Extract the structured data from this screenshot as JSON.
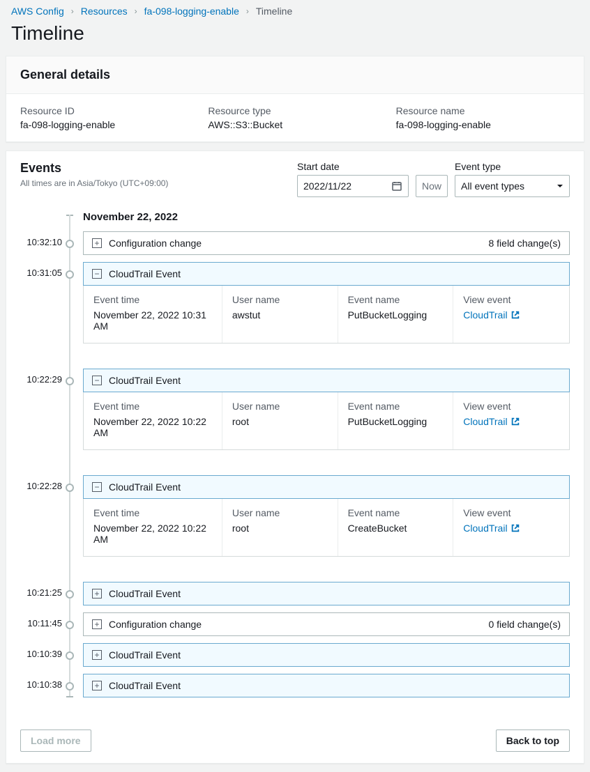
{
  "breadcrumb": {
    "items": [
      {
        "label": "AWS Config",
        "link": true
      },
      {
        "label": "Resources",
        "link": true
      },
      {
        "label": "fa-098-logging-enable",
        "link": true
      },
      {
        "label": "Timeline",
        "link": false
      }
    ]
  },
  "page_title": "Timeline",
  "general": {
    "heading": "General details",
    "resource_id_label": "Resource ID",
    "resource_id": "fa-098-logging-enable",
    "resource_type_label": "Resource type",
    "resource_type": "AWS::S3::Bucket",
    "resource_name_label": "Resource name",
    "resource_name": "fa-098-logging-enable"
  },
  "events": {
    "heading": "Events",
    "tz_note": "All times are in Asia/Tokyo (UTC+09:00)",
    "start_date_label": "Start date",
    "start_date_value": "2022/11/22",
    "now_label": "Now",
    "event_type_label": "Event type",
    "event_type_value": "All event types",
    "date_header": "November 22, 2022",
    "labels": {
      "event_time": "Event time",
      "user_name": "User name",
      "event_name": "Event name",
      "view_event": "View event",
      "cloudtrail_link": "CloudTrail",
      "config_change": "Configuration change",
      "cloudtrail_event": "CloudTrail Event"
    },
    "rows": [
      {
        "time": "10:32:10",
        "type": "config",
        "expanded": false,
        "meta": "8 field change(s)"
      },
      {
        "time": "10:31:05",
        "type": "cloudtrail",
        "expanded": true,
        "detail": {
          "event_time": "November 22, 2022 10:31 AM",
          "user_name": "awstut",
          "event_name": "PutBucketLogging"
        }
      },
      {
        "time": "10:22:29",
        "type": "cloudtrail",
        "expanded": true,
        "detail": {
          "event_time": "November 22, 2022 10:22 AM",
          "user_name": "root",
          "event_name": "PutBucketLogging"
        }
      },
      {
        "time": "10:22:28",
        "type": "cloudtrail",
        "expanded": true,
        "detail": {
          "event_time": "November 22, 2022 10:22 AM",
          "user_name": "root",
          "event_name": "CreateBucket"
        }
      },
      {
        "time": "10:21:25",
        "type": "cloudtrail",
        "expanded": false
      },
      {
        "time": "10:11:45",
        "type": "config",
        "expanded": false,
        "meta": "0 field change(s)"
      },
      {
        "time": "10:10:39",
        "type": "cloudtrail",
        "expanded": false
      },
      {
        "time": "10:10:38",
        "type": "cloudtrail",
        "expanded": false
      }
    ],
    "load_more": "Load more",
    "back_to_top": "Back to top"
  }
}
